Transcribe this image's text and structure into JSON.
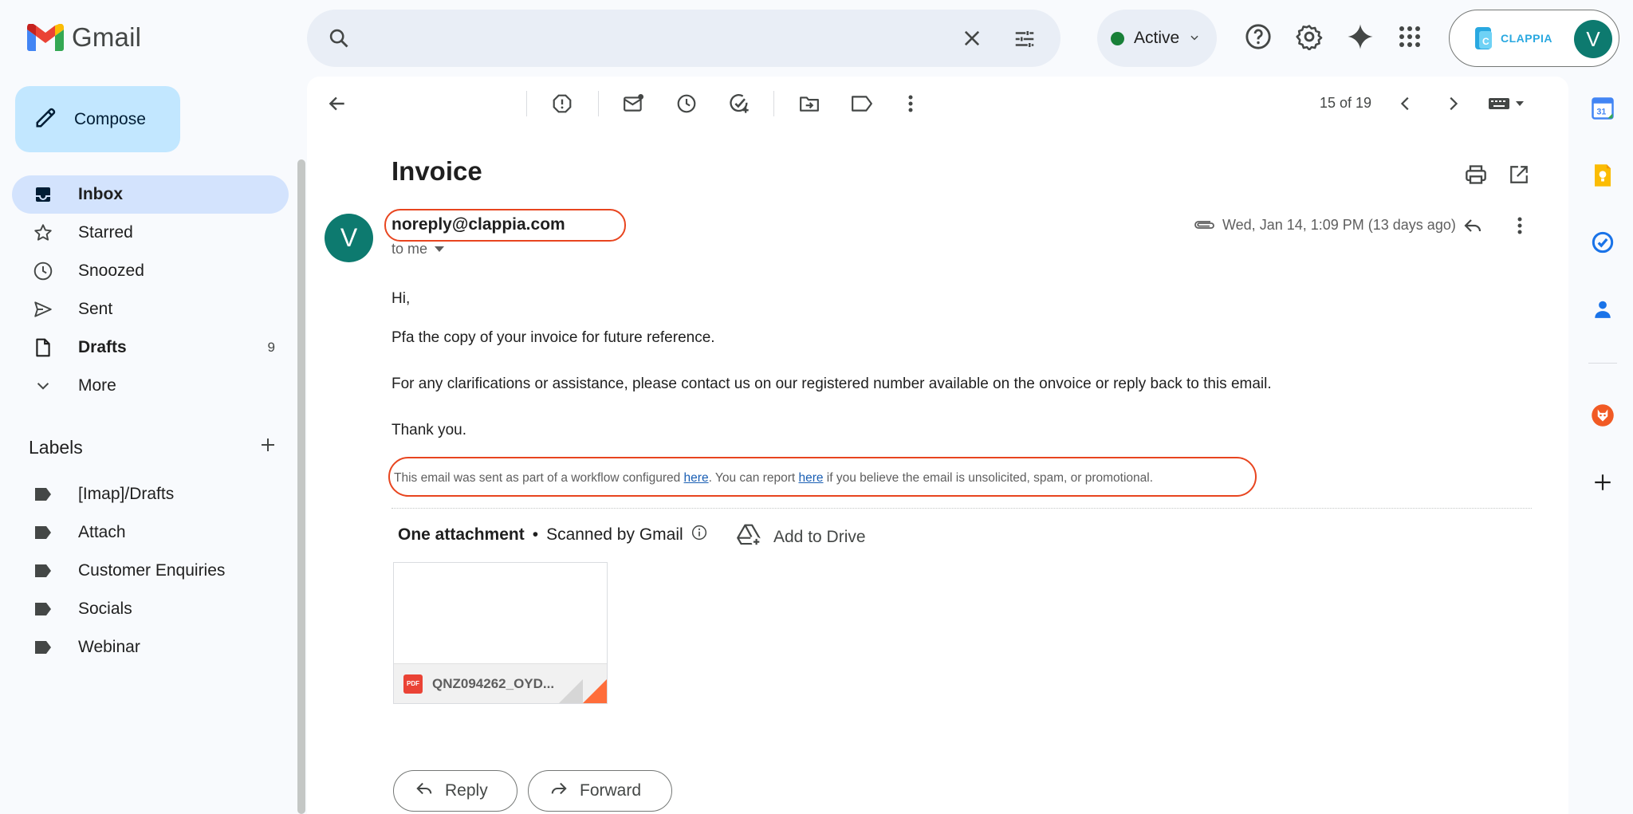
{
  "app": {
    "name": "Gmail"
  },
  "search": {
    "placeholder": ""
  },
  "status": {
    "label": "Active",
    "color": "#188038"
  },
  "account": {
    "brand": "CLAPPIA",
    "avatar_initial": "V"
  },
  "compose": {
    "label": "Compose"
  },
  "nav": {
    "items": [
      {
        "label": "Inbox",
        "icon": "inbox-icon",
        "active": true,
        "count": ""
      },
      {
        "label": "Starred",
        "icon": "star-icon",
        "count": ""
      },
      {
        "label": "Snoozed",
        "icon": "clock-icon",
        "count": ""
      },
      {
        "label": "Sent",
        "icon": "send-icon",
        "count": ""
      },
      {
        "label": "Drafts",
        "icon": "draft-icon",
        "count": "9"
      },
      {
        "label": "More",
        "icon": "chevron-down-icon",
        "count": ""
      }
    ]
  },
  "labels": {
    "heading": "Labels",
    "items": [
      "[Imap]/Drafts",
      "Attach",
      "Customer Enquiries",
      "Socials",
      "Webinar"
    ]
  },
  "toolbar": {
    "pager": "15 of 19"
  },
  "email": {
    "subject": "Invoice",
    "sender_initial": "V",
    "sender": "noreply@clappia.com",
    "to": "to me",
    "date": "Wed, Jan 14, 1:09 PM (13 days ago)",
    "body": {
      "greeting": "Hi,",
      "line1": "Pfa the copy of your invoice for future reference.",
      "line2": "For any clarifications or assistance, please contact us on our registered number available on the onvoice or reply back to this email.",
      "closing": "Thank you."
    },
    "footer": {
      "part1": "This email was sent as part of a workflow configured ",
      "link1": "here",
      "part2": ". You can report ",
      "link2": "here",
      "part3": " if you believe the email is unsolicited, spam, or promotional."
    }
  },
  "attachments": {
    "heading": "One attachment",
    "separator": "•",
    "scan": "Scanned by Gmail",
    "add_to_drive": "Add to Drive",
    "file_badge": "PDF",
    "file_name": "QNZ094262_OYD..."
  },
  "actions": {
    "reply": "Reply",
    "forward": "Forward"
  },
  "side_apps": {
    "calendar_day": "31",
    "items": [
      "calendar-icon",
      "keep-icon",
      "tasks-icon",
      "contacts-icon",
      "addon-icon",
      "add-icon"
    ]
  },
  "colors": {
    "highlight": "#e8451f",
    "accent": "#c2e7ff",
    "active_nav": "#d3e3fd"
  }
}
